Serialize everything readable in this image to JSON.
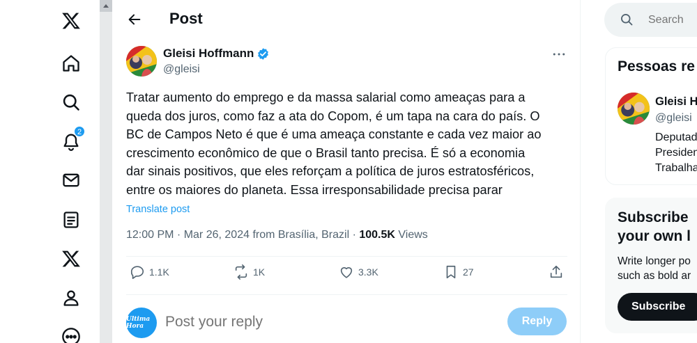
{
  "header": {
    "title": "Post"
  },
  "notifications_badge": "2",
  "post": {
    "author_name": "Gleisi Hoffmann",
    "author_handle": "@gleisi",
    "text_lines": [
      "Tratar aumento do emprego e da massa salarial como ameaças para a",
      "queda dos juros, como faz a ata do Copom, é um tapa na cara do país. O",
      "BC de Campos Neto é que é uma ameaça constante e cada vez maior ao",
      "crescimento econômico de que o Brasil tanto precisa. É só a economia",
      "dar sinais positivos, que eles reforçam a política de juros estratosféricos,",
      "entre os maiores do planeta. Essa irresponsabilidade precisa parar"
    ],
    "translate_label": "Translate post",
    "time": "12:00 PM",
    "date": "Mar 26, 2024",
    "location": "from Brasília, Brazil",
    "views_count": "100.5K",
    "views_label": "Views",
    "stats": {
      "replies": "1.1K",
      "reposts": "1K",
      "likes": "3.3K",
      "bookmarks": "27"
    }
  },
  "reply": {
    "placeholder": "Post your reply",
    "button_label": "Reply",
    "avatar_text": "Ultima Hora"
  },
  "search": {
    "placeholder": "Search"
  },
  "relevant_people": {
    "title": "Pessoas re",
    "person": {
      "name": "Gleisi H",
      "handle": "@gleisi",
      "bio_lines": [
        "Deputad",
        "Presiden",
        "Trabalha"
      ]
    }
  },
  "subscribe": {
    "title_lines": [
      "Subscribe",
      "your own l"
    ],
    "text_lines": [
      "Write longer po",
      "such as bold ar"
    ],
    "button_label": "Subscribe"
  },
  "colors": {
    "accent": "#1d9bf0",
    "text": "#0f1419",
    "muted": "#536471",
    "verified": "#1d9bf0"
  }
}
